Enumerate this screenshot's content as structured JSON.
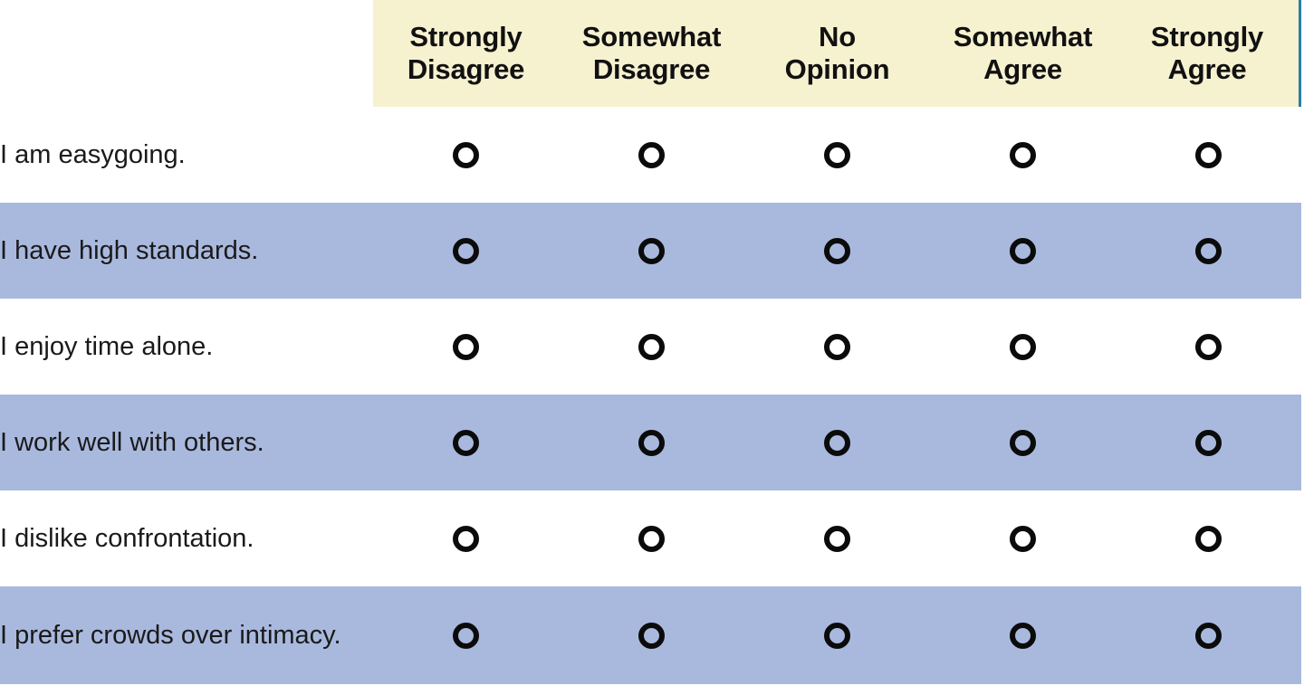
{
  "survey": {
    "corner_label": "",
    "scale_options": [
      {
        "line1": "Strongly",
        "line2": "Disagree"
      },
      {
        "line1": "Somewhat",
        "line2": "Disagree"
      },
      {
        "line1": "No",
        "line2": "Opinion"
      },
      {
        "line1": "Somewhat",
        "line2": "Agree"
      },
      {
        "line1": "Strongly",
        "line2": "Agree"
      }
    ],
    "statements": [
      "I am easygoing.",
      "I have high standards.",
      "I enjoy time alone.",
      "I work well with others.",
      "I dislike confrontation.",
      "I prefer crowds over intimacy."
    ],
    "radio_icon": "radio-unselected-icon",
    "colors": {
      "border": "#2c7ca6",
      "header_fill": "#f6f1cf",
      "row_shaded_fill": "#a9b9de",
      "row_plain_fill": "#ffffff",
      "text": "#1a1a1a",
      "radio_stroke": "#0b0b0b"
    }
  }
}
